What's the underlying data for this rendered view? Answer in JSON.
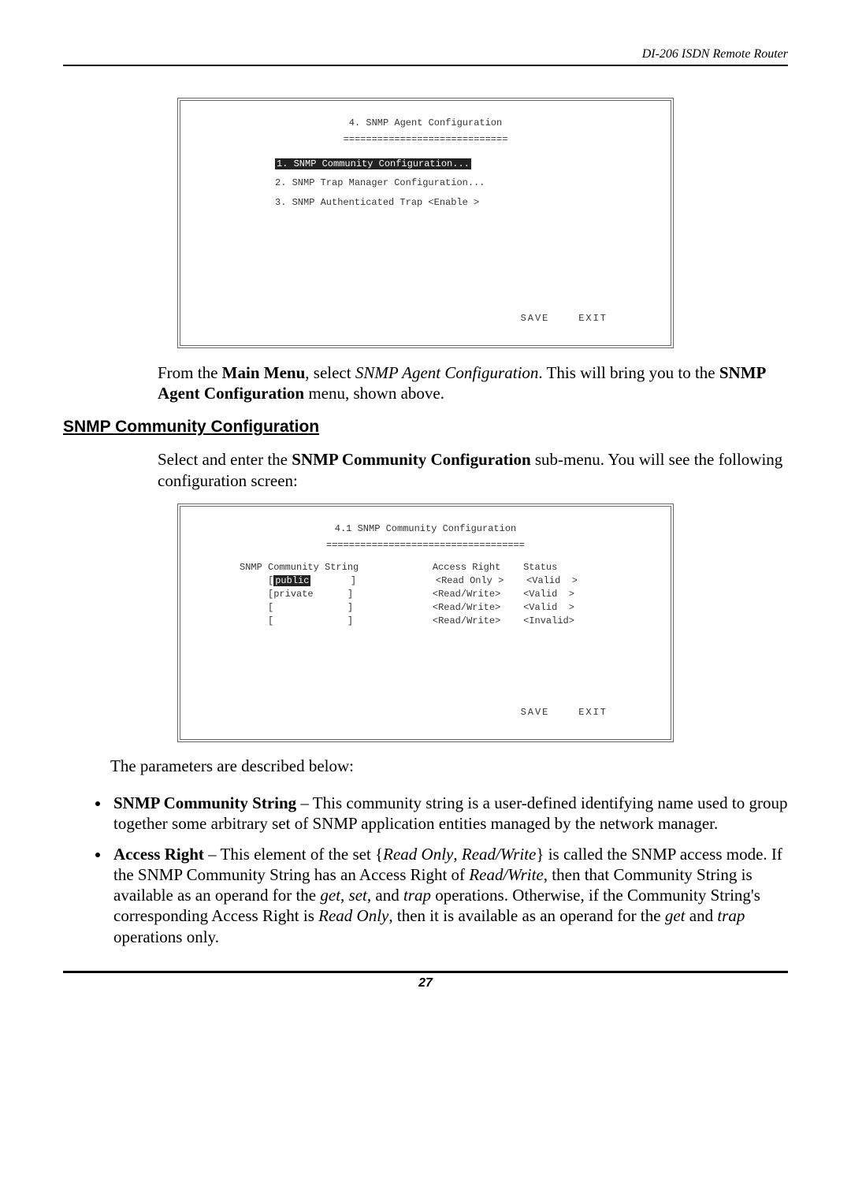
{
  "header": {
    "product": "DI-206 ISDN Remote Router"
  },
  "screen1": {
    "title": "4. SNMP Agent Configuration",
    "underline": "=============================",
    "item1": "1. SNMP Community Configuration...",
    "item2": "2. SNMP Trap Manager Configuration...",
    "item3": "3. SNMP Authenticated Trap <Enable >",
    "save": "SAVE",
    "exit": "EXIT"
  },
  "para1_a": "From the ",
  "para1_b": "Main Menu",
  "para1_c": ", select ",
  "para1_d": "SNMP Agent Configuration",
  "para1_e": ". This will bring you to the ",
  "para1_f": "SNMP Agent Configuration",
  "para1_g": " menu, shown above.",
  "section2": "SNMP Community Configuration",
  "para2_a": "Select and enter the ",
  "para2_b": "SNMP Community Configuration",
  "para2_c": " sub-menu. You will see the following configuration screen:",
  "screen2": {
    "title": "4.1 SNMP Community Configuration",
    "underline": "===================================",
    "hdr_col1": "SNMP Community String",
    "hdr_col2": "Access Right",
    "hdr_col3": "Status",
    "row1_l": "[",
    "row1_val": "public",
    "row1_r": "       ]",
    "row1_ar": "<Read Only >",
    "row1_st": "<Valid  >",
    "row2": "[private      ]",
    "row2_ar": "<Read/Write>",
    "row2_st": "<Valid  >",
    "row3": "[             ]",
    "row3_ar": "<Read/Write>",
    "row3_st": "<Valid  >",
    "row4": "[             ]",
    "row4_ar": "<Read/Write>",
    "row4_st": "<Invalid>",
    "save": "SAVE",
    "exit": "EXIT"
  },
  "para3": "The parameters are described below:",
  "bullet1_a": "SNMP Community String",
  "bullet1_b": " – This community string is a user-defined identifying name used to group together some arbitrary set of SNMP application entities managed by the network manager.",
  "bullet2_a": "Access Right",
  "bullet2_b": " – This element of the set {",
  "bullet2_c": "Read Only",
  "bullet2_d": ", ",
  "bullet2_e": "Read/Write",
  "bullet2_f": "} is called the SNMP access mode.  If the SNMP Community String has an Access Right of ",
  "bullet2_g": "Read/Write",
  "bullet2_h": ", then that Community String is available as an operand for the ",
  "bullet2_i": "get",
  "bullet2_j": ", ",
  "bullet2_k": "set",
  "bullet2_l": ", and ",
  "bullet2_m": "trap",
  "bullet2_n": " operations. Otherwise, if the Community String's corresponding Access Right is ",
  "bullet2_o": "Read Only",
  "bullet2_p": ", then it is available as an operand for the ",
  "bullet2_q": "get",
  "bullet2_r": " and ",
  "bullet2_s": "trap",
  "bullet2_t": " operations only.",
  "page_number": "27"
}
